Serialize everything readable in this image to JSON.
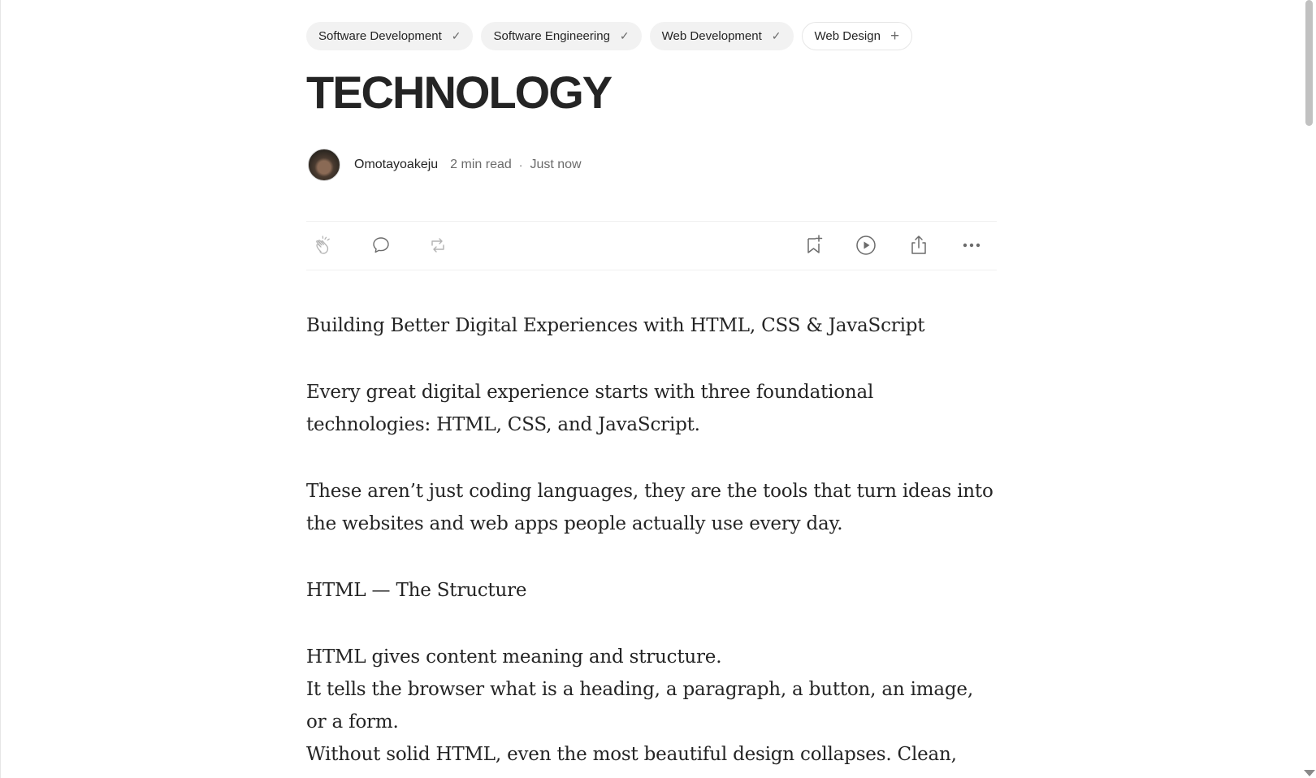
{
  "tags": [
    {
      "label": "Software Development",
      "icon": "checkmark-icon",
      "glyph": "✓"
    },
    {
      "label": "Software Engineering",
      "icon": "checkmark-icon",
      "glyph": "✓"
    },
    {
      "label": "Web Development",
      "icon": "checkmark-icon",
      "glyph": "✓"
    },
    {
      "label": "Web Design",
      "icon": "plus-icon",
      "glyph": "+"
    }
  ],
  "article": {
    "title": "TECHNOLOGY",
    "author": "Omotayoakeju",
    "read_time": "2 min read",
    "separator": "·",
    "published": "Just now"
  },
  "actions": {
    "left": [
      "clap-icon",
      "comment-icon",
      "repost-icon"
    ],
    "right": [
      "bookmark-add-icon",
      "listen-play-icon",
      "share-icon",
      "more-icon"
    ]
  },
  "body": {
    "p1": "Building Better Digital Experiences with HTML, CSS & JavaScript",
    "p2": "Every great digital experience starts with three foundational technologies: HTML, CSS, and JavaScript.",
    "p3": "These aren’t just coding languages, they are the tools that turn ideas into the websites and web apps people actually use every day.",
    "h_html": "HTML — The Structure",
    "p4a": "HTML gives content meaning and structure.",
    "p4b": "It tells the browser what is a heading, a paragraph, a button, an image, or a form.",
    "p4c": "Without solid HTML, even the most beautiful design collapses. Clean,"
  },
  "colors": {
    "text": "#242424",
    "muted": "#6b6b6b",
    "tag_bg": "#f2f2f2",
    "divider": "#f0f0f0"
  }
}
